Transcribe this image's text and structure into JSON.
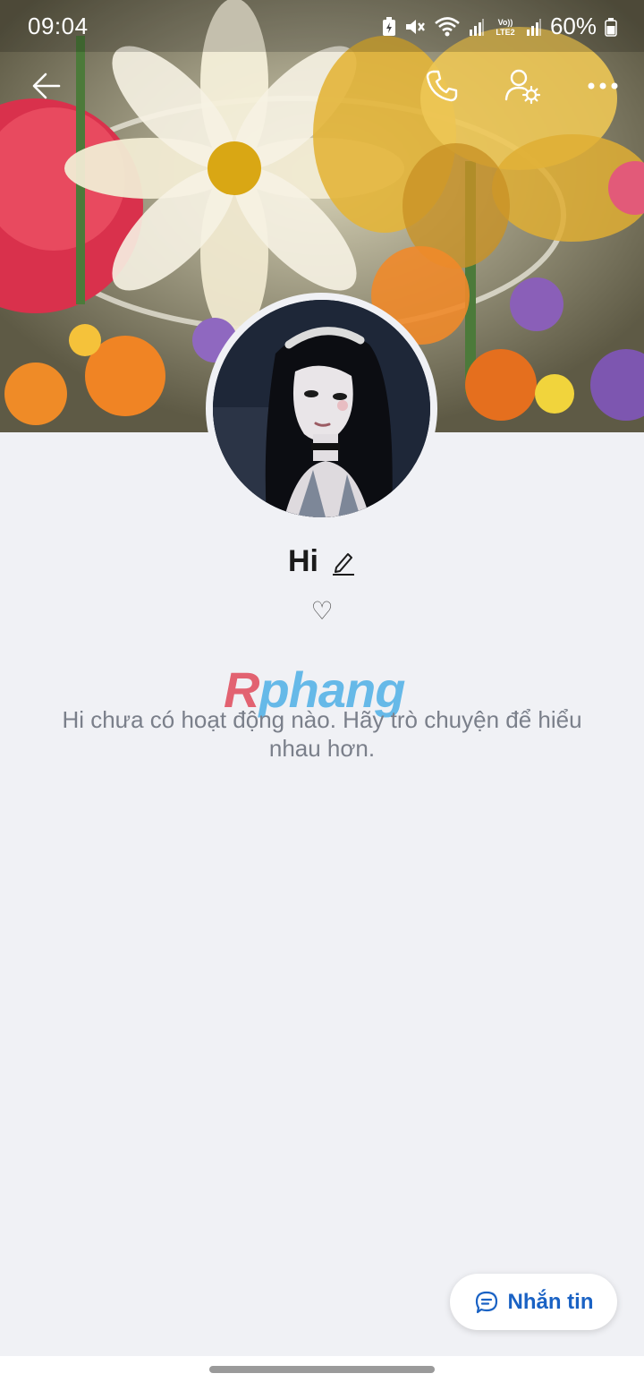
{
  "status_bar": {
    "time": "09:04",
    "battery_percent": "60%",
    "icons": [
      "battery-saver-icon",
      "mute-icon",
      "wifi-icon",
      "signal-icon",
      "volte-lte2-icon",
      "signal-2-icon",
      "battery-icon"
    ]
  },
  "top_bar": {
    "back_icon": "back-arrow-icon",
    "call_icon": "phone-icon",
    "profile_settings_icon": "user-settings-icon",
    "more_icon": "more-dots-icon"
  },
  "profile": {
    "name": "Hi",
    "edit_icon": "pencil-icon",
    "bio": "♡"
  },
  "watermark": {
    "first": "R",
    "rest": "phang"
  },
  "feed": {
    "empty_message": "Hi chưa có hoạt động nào. Hãy trò chuyện để hiểu nhau hơn."
  },
  "message_button": {
    "label": "Nhắn tin",
    "icon": "chat-bubble-icon"
  },
  "colors": {
    "accent": "#1a62c4",
    "background": "#f0f1f5"
  }
}
